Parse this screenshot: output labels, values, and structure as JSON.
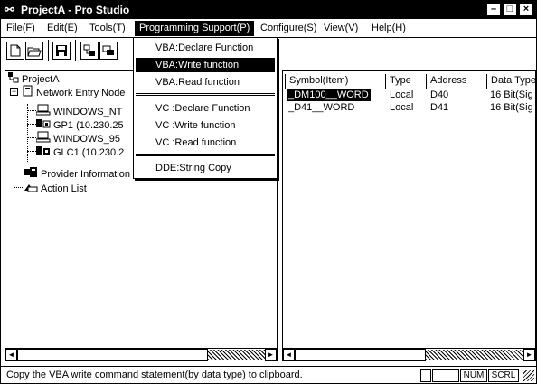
{
  "window": {
    "title": "ProjectA - Pro Studio",
    "minimize_glyph": "–",
    "maximize_glyph": "□",
    "close_glyph": "×"
  },
  "menubar": {
    "items": [
      {
        "label": "File(F)"
      },
      {
        "label": "Edit(E)"
      },
      {
        "label": "Tools(T)"
      },
      {
        "label": "Programming Support(P)"
      },
      {
        "label": "Configure(S)"
      },
      {
        "label": "View(V)"
      },
      {
        "label": "Help(H)"
      }
    ]
  },
  "dropdown": {
    "items": [
      {
        "label": "VBA:Declare Function"
      },
      {
        "label": "VBA:Write function"
      },
      {
        "label": "VBA:Read function"
      },
      {
        "label": "VC :Declare Function"
      },
      {
        "label": "VC :Write function"
      },
      {
        "label": "VC :Read function"
      },
      {
        "label": "DDE:String Copy"
      }
    ],
    "highlighted": "VBA:Write function"
  },
  "tree": {
    "root": "ProjectA",
    "network_node": "Network Entry Node",
    "nodes": [
      {
        "label": "WINDOWS_NT"
      },
      {
        "label": "GP1 (10.230.25"
      },
      {
        "label": "WINDOWS_95"
      },
      {
        "label": "GLC1 (10.230.2"
      }
    ],
    "provider": "Provider Information",
    "action_list": "Action List"
  },
  "symbol_list": {
    "columns": [
      "Symbol(Item)",
      "Type",
      "Address",
      "Data Type"
    ],
    "rows": [
      {
        "symbol": "_DM100__WORD",
        "type": "Local",
        "address": "D40",
        "data_type": "16 Bit(Sig"
      },
      {
        "symbol": "_D41__WORD",
        "type": "Local",
        "address": "D41",
        "data_type": "16 Bit(Sig"
      }
    ]
  },
  "statusbar": {
    "message": "Copy the VBA write command statement(by data type) to clipboard.",
    "num": "NUM",
    "scrl": "SCRL"
  }
}
